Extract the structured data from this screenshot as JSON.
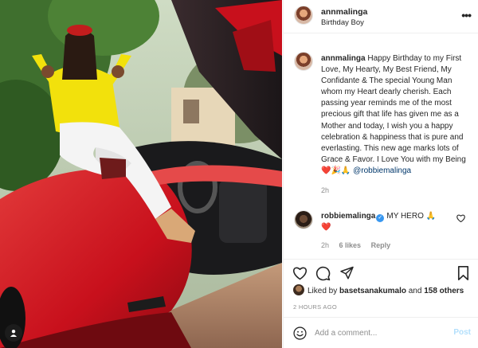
{
  "header": {
    "username": "annmalinga",
    "subtitle": "Birthday Boy",
    "more_icon": "more-dots-icon"
  },
  "caption": {
    "username": "annmalinga",
    "text": "Happy Birthday to my First Love, My Hearty, My Best Friend, My Confidante & The special Young Man whom my Heart dearly cherish. Each passing year reminds me of the most precious gift that life has given me as a Mother and today, I wish you a happy celebration & happiness that is pure and everlasting. This new age marks lots of Grace & Favor. I Love You with my Being",
    "emojis": "❤️🎉🙏",
    "mention": "@robbiemalinga",
    "time": "2h"
  },
  "comment": {
    "username": "robbiemalinga",
    "text": "MY HERO 🙏",
    "second_line": "❤️",
    "time": "2h",
    "likes": "6 likes",
    "reply": "Reply"
  },
  "actions": {
    "like_icon": "heart-icon",
    "comment_icon": "comment-icon",
    "share_icon": "share-icon",
    "save_icon": "bookmark-icon"
  },
  "likes": {
    "prefix": "Liked by ",
    "user": "basetsanakumalo",
    "middle": " and ",
    "others": "158 others"
  },
  "date": "2 HOURS AGO",
  "add_comment": {
    "placeholder": "Add a comment...",
    "post_label": "Post",
    "emoji_icon": "smiley-icon"
  },
  "colors": {
    "link": "#00376b",
    "muted": "#8e8e8e",
    "post_disabled": "#b2dffc",
    "car_red": "#d8202a",
    "heart": "#e0245e"
  }
}
